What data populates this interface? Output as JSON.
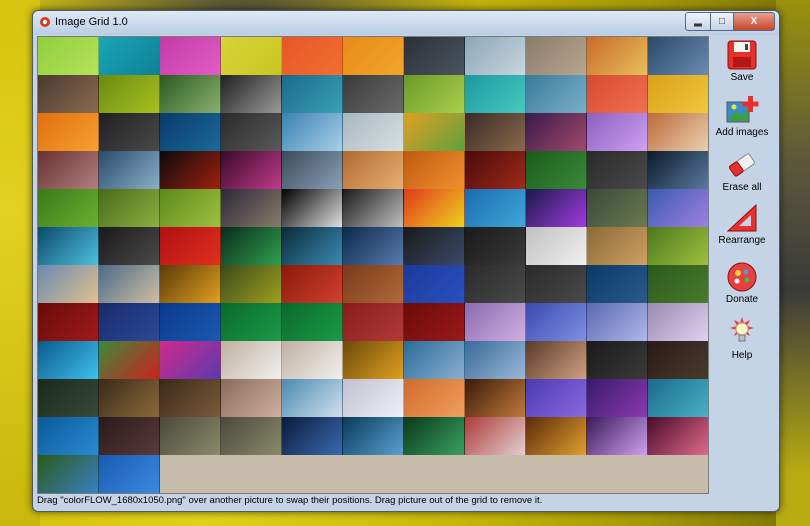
{
  "window": {
    "title": "Image Grid 1.0",
    "min_label": "▂",
    "max_label": "□",
    "close_label": "X"
  },
  "sidebar": {
    "save": "Save",
    "add_images": "Add images",
    "erase_all": "Erase all",
    "rearrange": "Rearrange",
    "donate": "Donate",
    "help": "Help"
  },
  "status_text": "Drag \"colorFLOW_1680x1050.png\" over another picture to swap their positions. Drag picture out of the grid to remove it.",
  "thumbnails": [
    [
      "#8fcf3c",
      "#b6e25a"
    ],
    [
      "#1aa6b8",
      "#0e7f95"
    ],
    [
      "#c43aa8",
      "#e05ec4"
    ],
    [
      "#d8d43a",
      "#c9c620"
    ],
    [
      "#e8552a",
      "#f0702e"
    ],
    [
      "#e88a1a",
      "#f0a52a"
    ],
    [
      "#2a3038",
      "#4a5560"
    ],
    [
      "#8aa8b8",
      "#c8d6de"
    ],
    [
      "#8a7a6a",
      "#b8a890"
    ],
    [
      "#c86a2a",
      "#e8c05a"
    ],
    [
      "#2a4a6a",
      "#6a8ab0"
    ],
    [
      "#4a3a30",
      "#8a6a50"
    ],
    [
      "#6a8a10",
      "#a8c020"
    ],
    [
      "#2a5a20",
      "#8ab070"
    ],
    [
      "#202020",
      "#9a9a9a"
    ],
    [
      "#1a6a8a",
      "#3aa0b8"
    ],
    [
      "#3a3a3a",
      "#6a6a6a"
    ],
    [
      "#6a9a2a",
      "#a8d04a"
    ],
    [
      "#1a9aa0",
      "#4ac8c0"
    ],
    [
      "#3a7a9a",
      "#7ab0c8"
    ],
    [
      "#d84a30",
      "#f07050"
    ],
    [
      "#d8a018",
      "#f0c840"
    ],
    [
      "#e07010",
      "#f8a030"
    ],
    [
      "#202020",
      "#4a4a4a"
    ],
    [
      "#0a3a6a",
      "#1a6a9a"
    ],
    [
      "#2a2a2a",
      "#5a5a5a"
    ],
    [
      "#3a80b0",
      "#a8d0e8"
    ],
    [
      "#a8b8c0",
      "#d8e0e0"
    ],
    [
      "#e0a020",
      "#60a040"
    ],
    [
      "#3a2a2a",
      "#8a6a4a"
    ],
    [
      "#3a1a4a",
      "#a04a6a"
    ],
    [
      "#8a60c0",
      "#d0a0f0"
    ],
    [
      "#c06a3a",
      "#e8d0b0"
    ],
    [
      "#6a3030",
      "#b08080"
    ],
    [
      "#2a4a6a",
      "#8ab0c8"
    ],
    [
      "#0a0a0a",
      "#a02010"
    ],
    [
      "#3a0a2a",
      "#c03a8a"
    ],
    [
      "#3a4a5a",
      "#8aa0b8"
    ],
    [
      "#b06a30",
      "#e8b070"
    ],
    [
      "#c05a10",
      "#f09030"
    ],
    [
      "#4a0a0a",
      "#a02a1a"
    ],
    [
      "#1a5a1a",
      "#3a8a3a"
    ],
    [
      "#2a2a2a",
      "#4a4a4a"
    ],
    [
      "#0a1a2a",
      "#5a7aa0"
    ],
    [
      "#3a7a1a",
      "#6ab030"
    ],
    [
      "#4a6a1a",
      "#8ab040"
    ],
    [
      "#5a8a1a",
      "#a0c040"
    ],
    [
      "#2a2a3a",
      "#8a7a6a"
    ],
    [
      "#000000",
      "#e0e0e0"
    ],
    [
      "#1a1a1a",
      "#c0c0c0"
    ],
    [
      "#e03a1a",
      "#f0d020"
    ],
    [
      "#1a6ab0",
      "#40a8d8"
    ],
    [
      "#1a1a4a",
      "#a03ae0"
    ],
    [
      "#3a4a3a",
      "#6a7a50"
    ],
    [
      "#3a5ab0",
      "#a080e0"
    ],
    [
      "#0a4a6a",
      "#50c0e0"
    ],
    [
      "#1a1a1a",
      "#4a4a4a"
    ],
    [
      "#b01010",
      "#e03020"
    ],
    [
      "#0a2a1a",
      "#30a050"
    ],
    [
      "#0a2a3a",
      "#3a8ab0"
    ],
    [
      "#0a2a4a",
      "#5a7ab0"
    ],
    [
      "#1a1a1a",
      "#3a4a6a"
    ],
    [
      "#1a1a1a",
      "#3a3a3a"
    ],
    [
      "#c0c0c0",
      "#f0f0f0"
    ],
    [
      "#8a6a3a",
      "#d0a060"
    ],
    [
      "#4a7a1a",
      "#a0c040"
    ],
    [
      "#6a8ab0",
      "#e0c090"
    ],
    [
      "#4a6a8a",
      "#d0c0a0"
    ],
    [
      "#5a3a0a",
      "#e0a020"
    ],
    [
      "#3a4a1a",
      "#a0a020"
    ],
    [
      "#8a1a0a",
      "#d04030"
    ],
    [
      "#7a3a1a",
      "#b06a3a"
    ],
    [
      "#1a3a9a",
      "#2a50c0"
    ],
    [
      "#2a2a2a",
      "#4a4a4a"
    ],
    [
      "#2a2a2a",
      "#4a4a4a"
    ],
    [
      "#0a3a6a",
      "#2a5a8a"
    ],
    [
      "#2a5a1a",
      "#4a7a2a"
    ],
    [
      "#6a0a0a",
      "#a01a1a"
    ],
    [
      "#1a2a6a",
      "#2a4a9a"
    ],
    [
      "#0a3a8a",
      "#1a5ab0"
    ],
    [
      "#0a6a2a",
      "#1a9a4a"
    ],
    [
      "#0a6a2a",
      "#1a9a4a"
    ],
    [
      "#8a1a1a",
      "#b03a3a"
    ],
    [
      "#6a0a0a",
      "#9a1a1a"
    ],
    [
      "#8a6ab0",
      "#d0b0e0"
    ],
    [
      "#3a4ab0",
      "#8090e0"
    ],
    [
      "#5a6ab0",
      "#b0b8e8"
    ],
    [
      "#9a8ab0",
      "#e0d0f0"
    ],
    [
      "#0a5a8a",
      "#40c0f0"
    ],
    [
      "#3a8a3a",
      "#d02020"
    ],
    [
      "#d02a8a",
      "#5a3ab0"
    ],
    [
      "#c0b0a0",
      "#f0f0f0"
    ],
    [
      "#c0b0a0",
      "#f0f0f0"
    ],
    [
      "#6a4a0a",
      "#e0a020"
    ],
    [
      "#2a6a9a",
      "#8ab0d0"
    ],
    [
      "#3a6a9a",
      "#9ab8d8"
    ],
    [
      "#5a3a2a",
      "#d0a080"
    ],
    [
      "#1a1a1a",
      "#3a3a3a"
    ],
    [
      "#2a1a1a",
      "#4a3a2a"
    ],
    [
      "#1a2a1a",
      "#3a4a3a"
    ],
    [
      "#3a2a1a",
      "#8a6a3a"
    ],
    [
      "#3a2a1a",
      "#7a5a3a"
    ],
    [
      "#8a6a5a",
      "#d0b0a0"
    ],
    [
      "#4a8ab0",
      "#d0e0f0"
    ],
    [
      "#c0c0d0",
      "#f0f0f8"
    ],
    [
      "#d06a2a",
      "#f0a060"
    ],
    [
      "#3a1a0a",
      "#c07a3a"
    ],
    [
      "#4a3ab0",
      "#8a6ae0"
    ],
    [
      "#3a1a6a",
      "#8a3ab0"
    ],
    [
      "#1a6a8a",
      "#4ab0c8"
    ],
    [
      "#0a5a9a",
      "#2a8ad0"
    ],
    [
      "#2a1a1a",
      "#5a3a3a"
    ],
    [
      "#4a4a3a",
      "#8a8a6a"
    ],
    [
      "#4a4a3a",
      "#8a8a6a"
    ],
    [
      "#0a1a3a",
      "#3a6ab0"
    ],
    [
      "#0a3a5a",
      "#5aa0d0"
    ],
    [
      "#0a3a1a",
      "#3aa060"
    ],
    [
      "#b03a3a",
      "#e0d0d0"
    ],
    [
      "#5a2a0a",
      "#e0a030"
    ],
    [
      "#3a1a5a",
      "#d0a0f0"
    ],
    [
      "#4a0a2a",
      "#e06a8a"
    ],
    [
      "#2a5a1a",
      "#3a80c0"
    ],
    [
      "#1a5ab0",
      "#3a8ae0"
    ]
  ]
}
